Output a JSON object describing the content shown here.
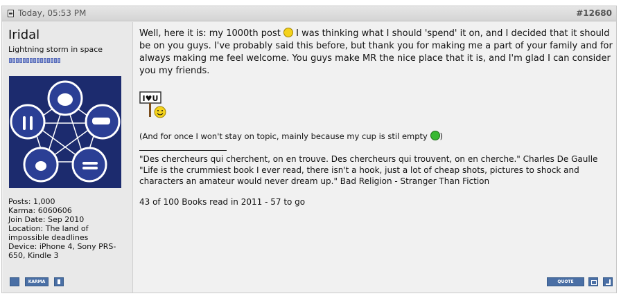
{
  "header": {
    "date": "Today, 05:53 PM",
    "post_number": "#12680"
  },
  "user": {
    "name": "Iridal",
    "title": "Lightning storm in space",
    "stats": {
      "posts": "Posts: 1,000",
      "karma": "Karma: 6060606",
      "join_date": "Join Date: Sep 2010",
      "location": "Location: The land of impossible deadlines",
      "device": "Device: iPhone 4, Sony PRS-650, Kindle 3"
    },
    "buttons": {
      "karma": "KARMA",
      "quote": "QUOTE"
    }
  },
  "message": {
    "p1_a": "Well, here it is: my 1000th post",
    "p1_b": "I was thinking what I should 'spend' it on, and I decided that it should be on you guys. I've probably said this before, but thank you for making me a part of your family and for always making me feel welcome. You guys make MR the nice place that it is, and I'm glad I can consider you my friends.",
    "sign_text": "I♥U",
    "aside": "(And for once I won't stay on topic, mainly because my cup is stil empty",
    "aside_end": ")"
  },
  "signature": {
    "quote1": "\"Des chercheurs qui cherchent, on en trouve. Des chercheurs qui trouvent, on en cherche.\" Charles De Gaulle",
    "quote2": "\"Life is the crummiest book I ever read, there isn't a hook, just a lot of cheap shots, pictures to shock and characters an amateur would never dream up.\" Bad Religion - Stranger Than Fiction",
    "books_a": "43 of 100",
    "books_b": "Books read in 2011",
    "books_c": "- 57 to go"
  },
  "colors": {
    "avatar_bg": "#1c2b6e",
    "button_blue": "#4a6fa5"
  },
  "icons": [
    "document-icon",
    "smiley-icon",
    "green-grin-icon",
    "i-love-u-sign-icon",
    "edit-icon",
    "report-icon",
    "multiquote-icon",
    "reply-icon"
  ]
}
